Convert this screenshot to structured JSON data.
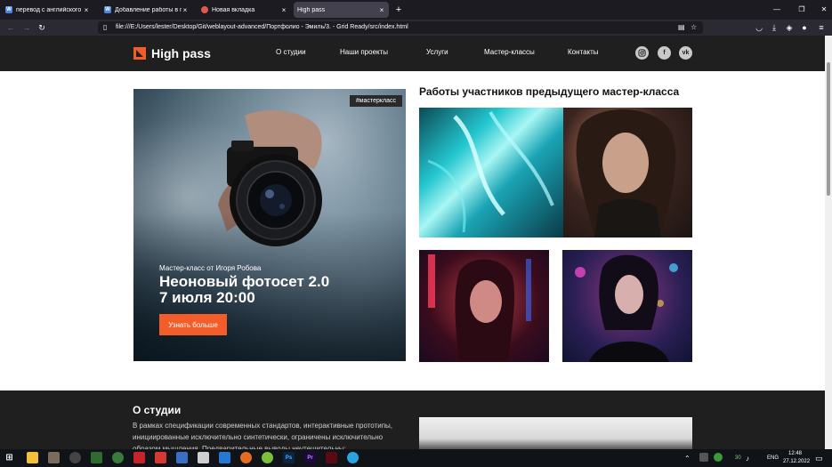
{
  "browser": {
    "tabs": [
      {
        "label": "перевод с английского на ру...",
        "favicon": "W",
        "favicon_color": "#4a86e8",
        "active": false
      },
      {
        "label": "Добавление работы в портф...",
        "favicon": "W",
        "favicon_color": "#4a86e8",
        "active": false
      },
      {
        "label": "Новая вкладка",
        "favicon": "",
        "favicon_color": "#e2574c",
        "active": false
      },
      {
        "label": "High pass",
        "favicon": "",
        "favicon_color": "#42414d",
        "active": true
      }
    ],
    "close_glyph": "×",
    "new_tab_glyph": "+",
    "window_controls": [
      "—",
      "❐",
      "✕"
    ],
    "url": "file:///E:/Users/lester/Desktop/Git/weblayout-advanced/Портфолио - Эмиль/3. - Grid Ready/src/index.html"
  },
  "site": {
    "logo_text": "High pass",
    "menu": [
      "О студии",
      "Наши проекты",
      "Услуги",
      "Мастер-классы",
      "Контакты"
    ],
    "social": [
      "instagram-icon",
      "facebook-icon",
      "vk-icon"
    ],
    "social_labels": {
      "facebook": "f",
      "vk": "vk"
    },
    "accent_color": "#f25d29",
    "header_color": "#1f1f1f"
  },
  "hero": {
    "badge": "#мастеркласс",
    "subtitle": "Мастер-класс от Игоря Робова",
    "title_line1": "Неоновый фотосет 2.0",
    "title_line2": "7 июля 20:00",
    "button": "Узнать больше"
  },
  "works": {
    "title": "Работы участников предыдущего мастер-класса"
  },
  "about": {
    "title": "О студии",
    "text": "В рамках спецификации современных стандартов, интерактивные прототипы, инициированные исключительно синтетически, ограничены исключительно образом мышления. Предварительные выводы неутешительны:"
  },
  "taskbar": {
    "lang": "ENG",
    "time": "12:48",
    "date": "27.12.2022",
    "tray_number": "30"
  }
}
